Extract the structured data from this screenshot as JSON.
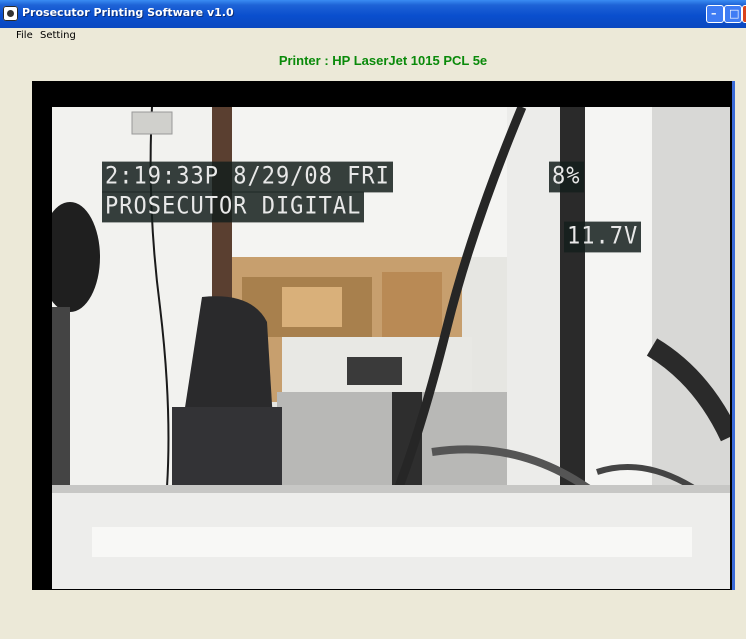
{
  "window": {
    "title": "Prosecutor Printing Software v1.0"
  },
  "menu": {
    "items": [
      "File",
      "Setting"
    ]
  },
  "printer": {
    "label": "Printer : HP LaserJet 1015 PCL 5e",
    "color": "#0A8A0A"
  },
  "video": {
    "osd_time": "2:19:33P  8/29/08 FRI",
    "osd_brand": "PROSECUTOR DIGITAL",
    "osd_battery_pct": "8%",
    "osd_voltage": "11.7V"
  },
  "colors": {
    "titlebar": "#0A4FCE",
    "background": "#ECE9D8"
  }
}
